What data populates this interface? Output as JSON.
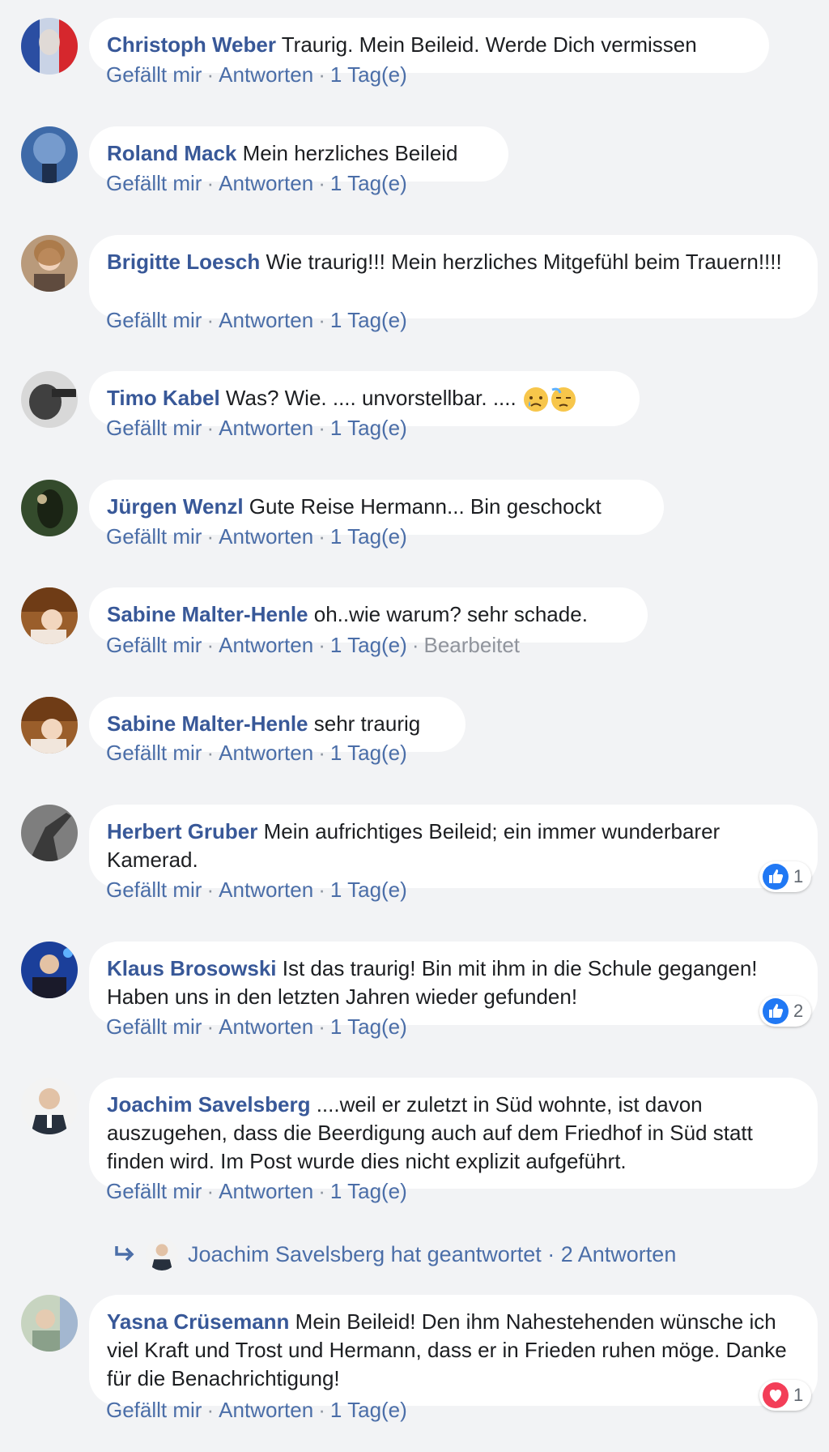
{
  "labels": {
    "like": "Gefällt mir",
    "reply": "Antworten",
    "separator": "·"
  },
  "comments": [
    {
      "author": "Christoph Weber",
      "text": "Traurig. Mein Beileid. Werde Dich vermissen",
      "time": "1 Tag(e)"
    },
    {
      "author": "Roland Mack",
      "text": "Mein herzliches Beileid",
      "time": "1 Tag(e)"
    },
    {
      "author": "Brigitte Loesch",
      "text": "Wie traurig!!! Mein herzliches Mitgefühl beim Trauern!!!!",
      "time": "1 Tag(e)"
    },
    {
      "author": "Timo Kabel",
      "text": "Was? Wie. .... unvorstellbar. ....",
      "time": "1 Tag(e)"
    },
    {
      "author": "Jürgen Wenzl",
      "text": "Gute Reise Hermann... Bin geschockt",
      "time": "1 Tag(e)"
    },
    {
      "author": "Sabine Malter-Henle",
      "text": "oh..wie warum? sehr schade.",
      "time": "1 Tag(e)",
      "edited": "Bearbeitet"
    },
    {
      "author": "Sabine Malter-Henle",
      "text": "sehr traurig",
      "time": "1 Tag(e)"
    },
    {
      "author": "Herbert Gruber",
      "text": "Mein aufrichtiges Beileid; ein immer wunderbarer Kamerad.",
      "time": "1 Tag(e)",
      "reaction": {
        "icon": "like-reaction-icon",
        "count": "1"
      }
    },
    {
      "author": "Klaus Brosowski",
      "text": "Ist das traurig! Bin mit ihm in die Schule gegangen! Haben uns in den letzten Jahren wieder gefunden!",
      "time": "1 Tag(e)",
      "reaction": {
        "icon": "like-reaction-icon",
        "count": "2"
      }
    },
    {
      "author": "Joachim Savelsberg",
      "text": "....weil er zuletzt in Süd wohnte, ist davon auszugehen, dass die Beerdigung auch auf dem Friedhof in Süd statt finden wird. Im Post wurde dies nicht explizit aufgeführt.",
      "time": "1 Tag(e)"
    },
    {
      "author": "Yasna Crüsemann",
      "text": "Mein Beileid! Den ihm Nahestehenden wünsche ich viel Kraft und Trost und Hermann, dass er in Frieden ruhen möge. Danke für die Benachrichtigung!",
      "time": "1 Tag(e)",
      "reaction": {
        "icon": "love-reaction-icon",
        "count": "1"
      }
    }
  ],
  "replies_summary": {
    "text": "Joachim Savelsberg hat geantwortet · 2 Antworten"
  },
  "colors": {
    "background": "#f2f3f5",
    "bubble": "#ffffff",
    "author": "#385898",
    "action_link": "#4b6ea8",
    "like_blue": "#2078f4",
    "love_red": "#f33e58"
  }
}
